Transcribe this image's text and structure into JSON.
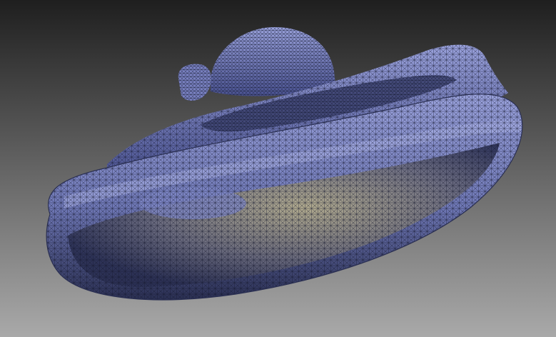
{
  "viewport": {
    "background_top": "#1f1f1f",
    "background_bottom": "#a9a9a9",
    "mesh_fill": "#6f78b6",
    "mesh_fill_light": "#9aa2dc",
    "mesh_fill_dark": "#2a2f52",
    "wire_color": "#14172c",
    "inner_glow": "#b8b08a",
    "render_mode": "wireframe-shaded",
    "object": "scanned-3d-mesh"
  }
}
